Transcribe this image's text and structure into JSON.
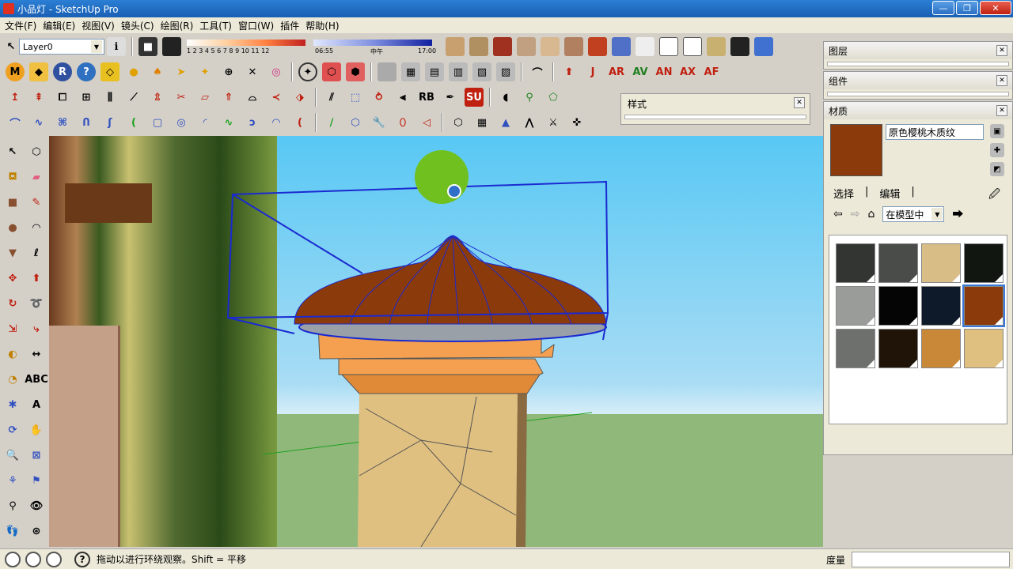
{
  "window": {
    "title": "小品灯 - SketchUp Pro",
    "buttons": {
      "minimize": "—",
      "maximize": "❐",
      "close": "✕"
    }
  },
  "menu": [
    "文件(F)",
    "编辑(E)",
    "视图(V)",
    "镜头(C)",
    "绘图(R)",
    "工具(T)",
    "窗口(W)",
    "插件",
    "帮助(H)"
  ],
  "toolbar": {
    "layer_value": "Layer0",
    "shadow": {
      "month_ticks": "1  2  3  4  5  6  7  8  9  10 11 12",
      "time_start": "06:55",
      "time_mid": "中午",
      "time_end": "17:00"
    }
  },
  "style_panel": {
    "title": "样式"
  },
  "panels": {
    "layers": {
      "title": "图层"
    },
    "components": {
      "title": "组件"
    },
    "materials": {
      "title": "材质",
      "name_value": "原色樱桃木质纹",
      "tab_select": "选择",
      "tab_edit": "编辑",
      "collection_value": "在模型中",
      "swatches": [
        "#333533",
        "#4a4c4a",
        "#d8bd86",
        "#111611",
        "#9a9c9a",
        "#050505",
        "#0e1a2a",
        "#8b3a0c",
        "#6e706e",
        "#201408",
        "#c88838",
        "#e0c080"
      ],
      "selected_index": 7
    }
  },
  "statusbar": {
    "message": "拖动以进行环绕观察。Shift = 平移",
    "measure_label": "度量",
    "measure_value": ""
  },
  "colors": {
    "lamp_top": "#8b3a0c",
    "lamp_base": "#f4a050",
    "stone": "#e0c080",
    "selection": "#1a2ad0",
    "sky": "#58c8f4",
    "ground": "#8fb87a"
  }
}
